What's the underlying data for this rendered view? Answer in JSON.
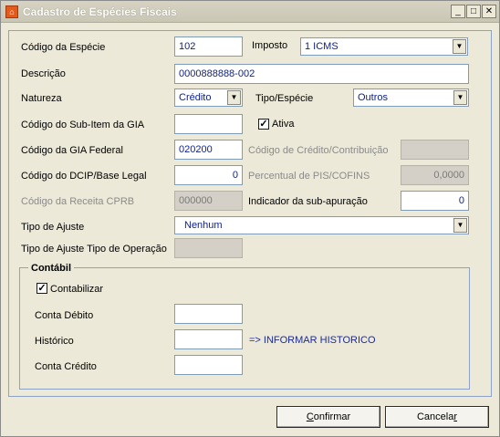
{
  "window": {
    "title": "Cadastro de Espécies Fiscais",
    "controls": {
      "minimize": "_",
      "maximize": "□",
      "close": "✕"
    },
    "icon": "app-icon"
  },
  "form": {
    "codigo_especie": {
      "label": "Código da Espécie",
      "value": "102"
    },
    "imposto": {
      "label": "Imposto",
      "value": "1 ICMS"
    },
    "descricao": {
      "label": "Descrição",
      "value": "0000888888-002"
    },
    "natureza": {
      "label": "Natureza",
      "value": "Crédito"
    },
    "tipo_especie": {
      "label": "Tipo/Espécie",
      "value": "Outros"
    },
    "sub_item_gia": {
      "label": "Código do Sub-Item da GIA",
      "value": ""
    },
    "ativa": {
      "label": "Ativa",
      "checked": true
    },
    "gia_federal": {
      "label": "Código da GIA Federal",
      "value": "020200"
    },
    "credito_contribuicao": {
      "label": "Código de Crédito/Contribuição",
      "value": ""
    },
    "dcip": {
      "label": "Código do DCIP/Base Legal",
      "value": "0"
    },
    "percentual_pis": {
      "label": "Percentual de PIS/COFINS",
      "value": "0,0000"
    },
    "receita_cprb": {
      "label": "Código da Receita CPRB",
      "value": "000000"
    },
    "sub_apuracao": {
      "label": "Indicador da sub-apuração",
      "value": "0"
    },
    "tipo_ajuste": {
      "label": "Tipo de Ajuste",
      "value": "Nenhum"
    },
    "tipo_ajuste_operacao": {
      "label": "Tipo de Ajuste Tipo de Operação",
      "value": ""
    }
  },
  "contabil": {
    "title": "Contábil",
    "contabilizar": {
      "label": "Contabilizar",
      "checked": true
    },
    "conta_debito": {
      "label": "Conta Débito",
      "value": ""
    },
    "historico": {
      "label": "Histórico",
      "value": "",
      "hint": "=> INFORMAR HISTORICO"
    },
    "conta_credito": {
      "label": "Conta Crédito",
      "value": ""
    }
  },
  "buttons": {
    "confirmar": {
      "underline": "C",
      "rest": "onfirmar"
    },
    "cancelar": {
      "rest_before": "Cancela",
      "underline": "r"
    }
  },
  "colors": {
    "field_text": "#0a1f8f",
    "disabled_text": "#8a8a8a",
    "hint_text": "#1a2aa0"
  }
}
